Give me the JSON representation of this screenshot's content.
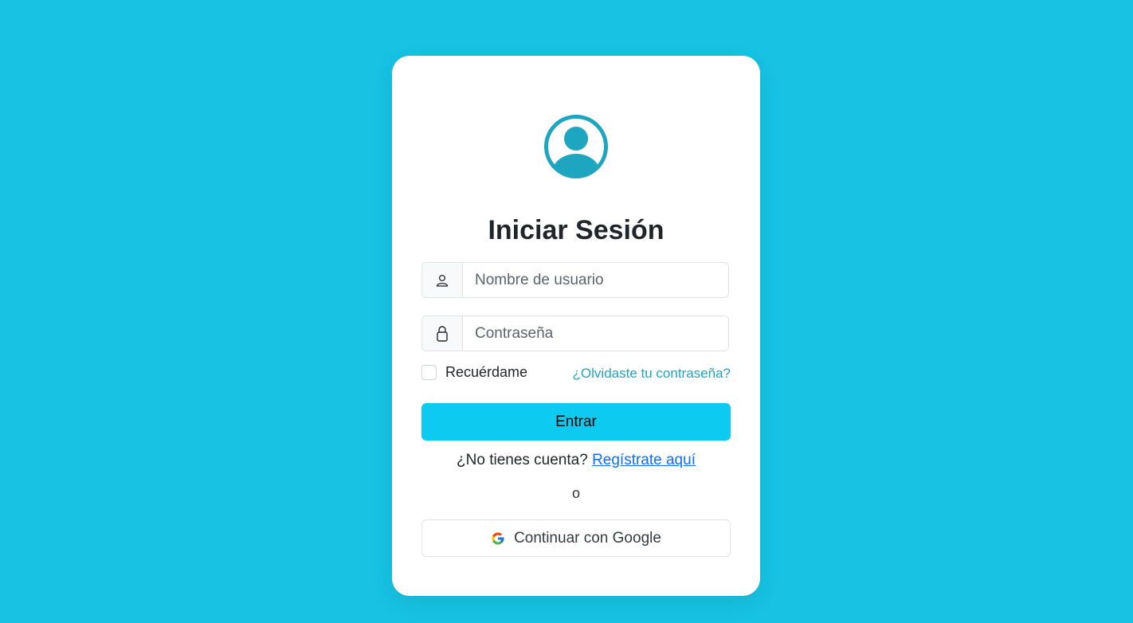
{
  "login": {
    "title": "Iniciar Sesión",
    "username": {
      "placeholder": "Nombre de usuario",
      "value": "",
      "icon": "person-icon"
    },
    "password": {
      "placeholder": "Contraseña",
      "value": "",
      "icon": "lock-icon"
    },
    "remember_label": "Recuérdame",
    "remember_checked": false,
    "forgot_link": "¿Olvidaste tu contraseña?",
    "submit_label": "Entrar",
    "register_prompt": "¿No tienes cuenta?",
    "register_link": "Regístrate aquí",
    "or_text": "o",
    "google_label": "Continuar con Google"
  },
  "colors": {
    "background": "#17c2e2",
    "card": "#ffffff",
    "primary_button": "#0dcaf0",
    "avatar": "#1ea5bf",
    "link": "#0d6efd",
    "forgot_link": "#1ea5bf"
  }
}
